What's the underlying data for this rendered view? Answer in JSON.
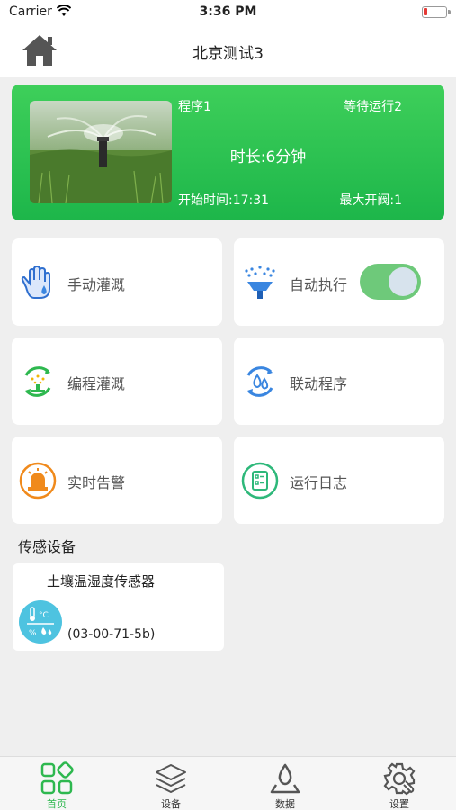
{
  "status_bar": {
    "carrier": "Carrier",
    "time": "3:36 PM"
  },
  "header": {
    "title": "北京测试3"
  },
  "banner": {
    "program": "程序1",
    "waiting": "等待运行2",
    "duration": "时长:6分钟",
    "start_time": "开始时间:17:31",
    "max_valves": "最大开阀:1"
  },
  "functions": [
    {
      "label": "手动灌溉",
      "icon": "hand-icon"
    },
    {
      "label": "自动执行",
      "icon": "sprinkler-icon",
      "toggle_on": true
    },
    {
      "label": "编程灌溉",
      "icon": "program-cycle-icon"
    },
    {
      "label": "联动程序",
      "icon": "linkage-cycle-icon"
    },
    {
      "label": "实时告警",
      "icon": "alarm-icon"
    },
    {
      "label": "运行日志",
      "icon": "log-icon"
    }
  ],
  "sensors": {
    "title": "传感设备",
    "items": [
      {
        "name": "土壤温湿度传感器",
        "address": "(03-00-71-5b)",
        "icon": "temp-humidity-icon"
      }
    ]
  },
  "tabs": [
    {
      "label": "首页",
      "icon": "home-grid-icon",
      "active": true
    },
    {
      "label": "设备",
      "icon": "layers-icon"
    },
    {
      "label": "数据",
      "icon": "data-icon"
    },
    {
      "label": "设置",
      "icon": "gear-icon"
    }
  ],
  "colors": {
    "accent": "#2eb84f",
    "banner": "#1db64a",
    "toggle": "#6ec97a"
  }
}
